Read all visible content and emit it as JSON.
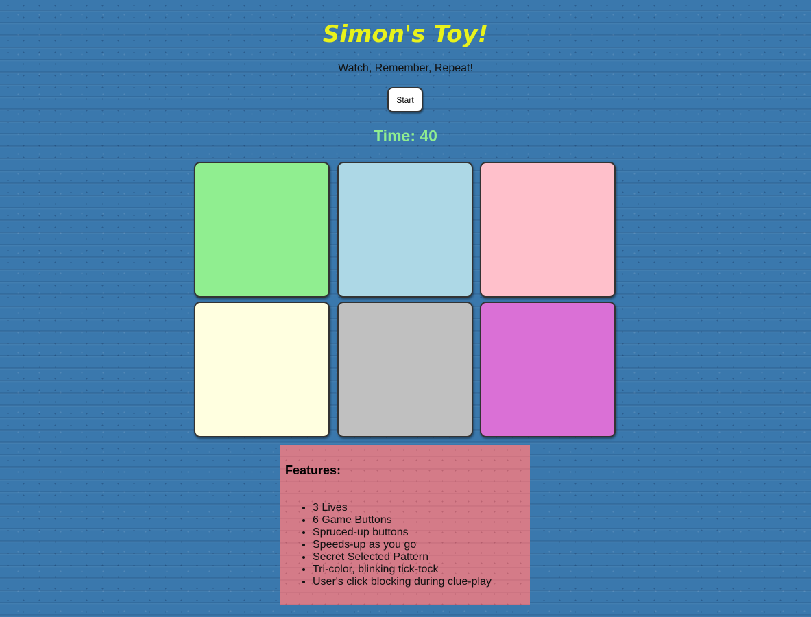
{
  "header": {
    "title": "Simon's Toy!",
    "subtitle": "Watch, Remember, Repeat!"
  },
  "controls": {
    "start_label": "Start"
  },
  "timer": {
    "text": "Time: 40"
  },
  "game_buttons": [
    {
      "color": "#90ee90"
    },
    {
      "color": "#add8e6"
    },
    {
      "color": "#ffc0cb"
    },
    {
      "color": "#ffffe0"
    },
    {
      "color": "#c0c0c0"
    },
    {
      "color": "#da70d6"
    }
  ],
  "features": {
    "heading": "Features:",
    "items": [
      "3 Lives",
      "6 Game Buttons",
      "Spruced-up buttons",
      "Speeds-up as you go",
      "Secret Selected Pattern",
      "Tri-color, blinking tick-tock",
      "User's click blocking during clue-play"
    ]
  }
}
